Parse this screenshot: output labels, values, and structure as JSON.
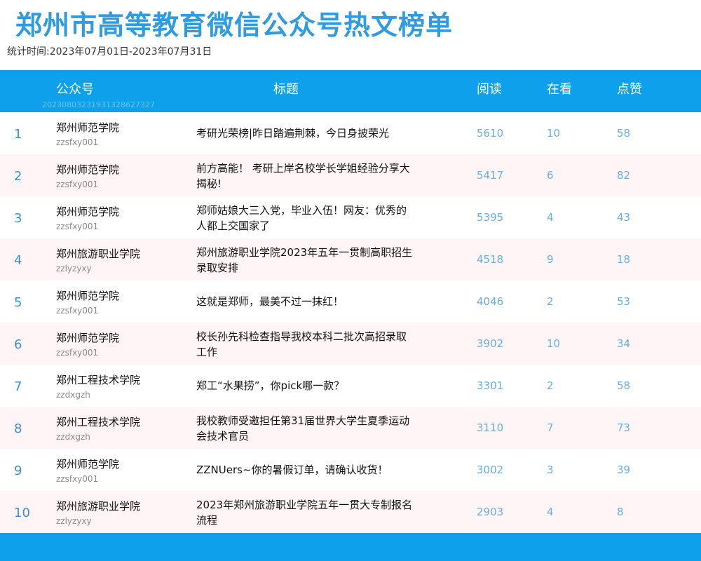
{
  "page": {
    "title": "郑州市高等教育微信公众号热文榜单",
    "period": "统计时间:2023年07月01日-2023年07月31日",
    "watermark": "20230803231931328627327"
  },
  "table": {
    "headers": {
      "account": "公众号",
      "title": "标题",
      "reads": "阅读",
      "watching": "在看",
      "likes": "点赞"
    },
    "rows": [
      {
        "rank": "1",
        "account": "郑州师范学院",
        "account_id": "zzsfxy001",
        "title": "考研光荣榜|昨日踏遍荆棘，今日身披荣光",
        "reads": "5610",
        "watching": "10",
        "likes": "58"
      },
      {
        "rank": "2",
        "account": "郑州师范学院",
        "account_id": "zzsfxy001",
        "title": "前方高能！ 考研上岸名校学长学姐经验分享大揭秘!",
        "reads": "5417",
        "watching": "6",
        "likes": "82"
      },
      {
        "rank": "3",
        "account": "郑州师范学院",
        "account_id": "zzsfxy001",
        "title": "郑师姑娘大三入党，毕业入伍！网友：优秀的人都上交国家了",
        "reads": "5395",
        "watching": "4",
        "likes": "43"
      },
      {
        "rank": "4",
        "account": "郑州旅游职业学院",
        "account_id": "zzlyzyxy",
        "title": "郑州旅游职业学院2023年五年一贯制高职招生录取安排",
        "reads": "4518",
        "watching": "9",
        "likes": "18"
      },
      {
        "rank": "5",
        "account": "郑州师范学院",
        "account_id": "zzsfxy001",
        "title": "这就是郑师，最美不过一抹红！",
        "reads": "4046",
        "watching": "2",
        "likes": "53"
      },
      {
        "rank": "6",
        "account": "郑州师范学院",
        "account_id": "zzsfxy001",
        "title": "校长孙先科检查指导我校本科二批次高招录取工作",
        "reads": "3902",
        "watching": "10",
        "likes": "34"
      },
      {
        "rank": "7",
        "account": "郑州工程技术学院",
        "account_id": "zzdxgzh",
        "title": "郑工“水果捞”，你pick哪一款？",
        "reads": "3301",
        "watching": "2",
        "likes": "58"
      },
      {
        "rank": "8",
        "account": "郑州工程技术学院",
        "account_id": "zzdxgzh",
        "title": "我校教师受邀担任第31届世界大学生夏季运动会技术官员",
        "reads": "3110",
        "watching": "7",
        "likes": "73"
      },
      {
        "rank": "9",
        "account": "郑州师范学院",
        "account_id": "zzsfxy001",
        "title": "ZZNUers~你的暑假订单，请确认收货！",
        "reads": "3002",
        "watching": "3",
        "likes": "39"
      },
      {
        "rank": "10",
        "account": "郑州旅游职业学院",
        "account_id": "zzlyzyxy",
        "title": "2023年郑州旅游职业学院五年一贯大专制报名流程",
        "reads": "2903",
        "watching": "4",
        "likes": "8"
      }
    ]
  },
  "colors": {
    "accent": "#0ea0ea",
    "title": "#2f9be0",
    "rank": "#3b8fd0",
    "numbers": "#6aaedc",
    "row_alt": "#fff5f6"
  }
}
